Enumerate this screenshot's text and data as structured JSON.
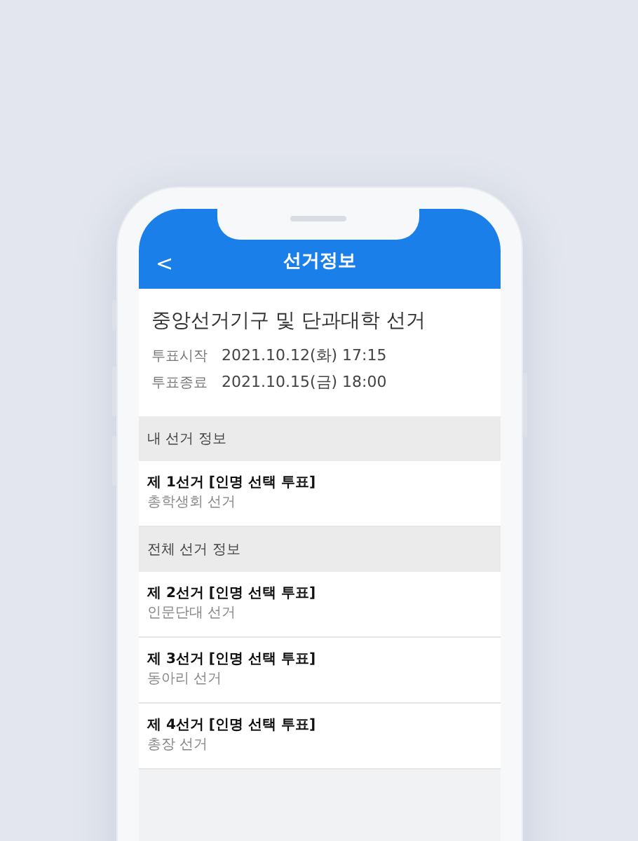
{
  "header": {
    "back": "<",
    "title": "선거정보"
  },
  "election": {
    "title": "중앙선거기구 및 단과대학 선거",
    "schedule": [
      {
        "label": "투표시작",
        "value": "2021.10.12(화) 17:15"
      },
      {
        "label": "투표종료",
        "value": "2021.10.15(금) 18:00"
      }
    ]
  },
  "sections": [
    {
      "heading": "내 선거 정보",
      "items": [
        {
          "title": "제 1선거 [인명 선택 투표]",
          "subtitle": "총학생회 선거"
        }
      ]
    },
    {
      "heading": "전체 선거 정보",
      "items": [
        {
          "title": "제 2선거 [인명 선택 투표]",
          "subtitle": "인문단대 선거"
        },
        {
          "title": "제 3선거 [인명 선택 투표]",
          "subtitle": "동아리 선거"
        },
        {
          "title": "제 4선거 [인명 선택 투표]",
          "subtitle": "총장 선거"
        }
      ]
    }
  ]
}
